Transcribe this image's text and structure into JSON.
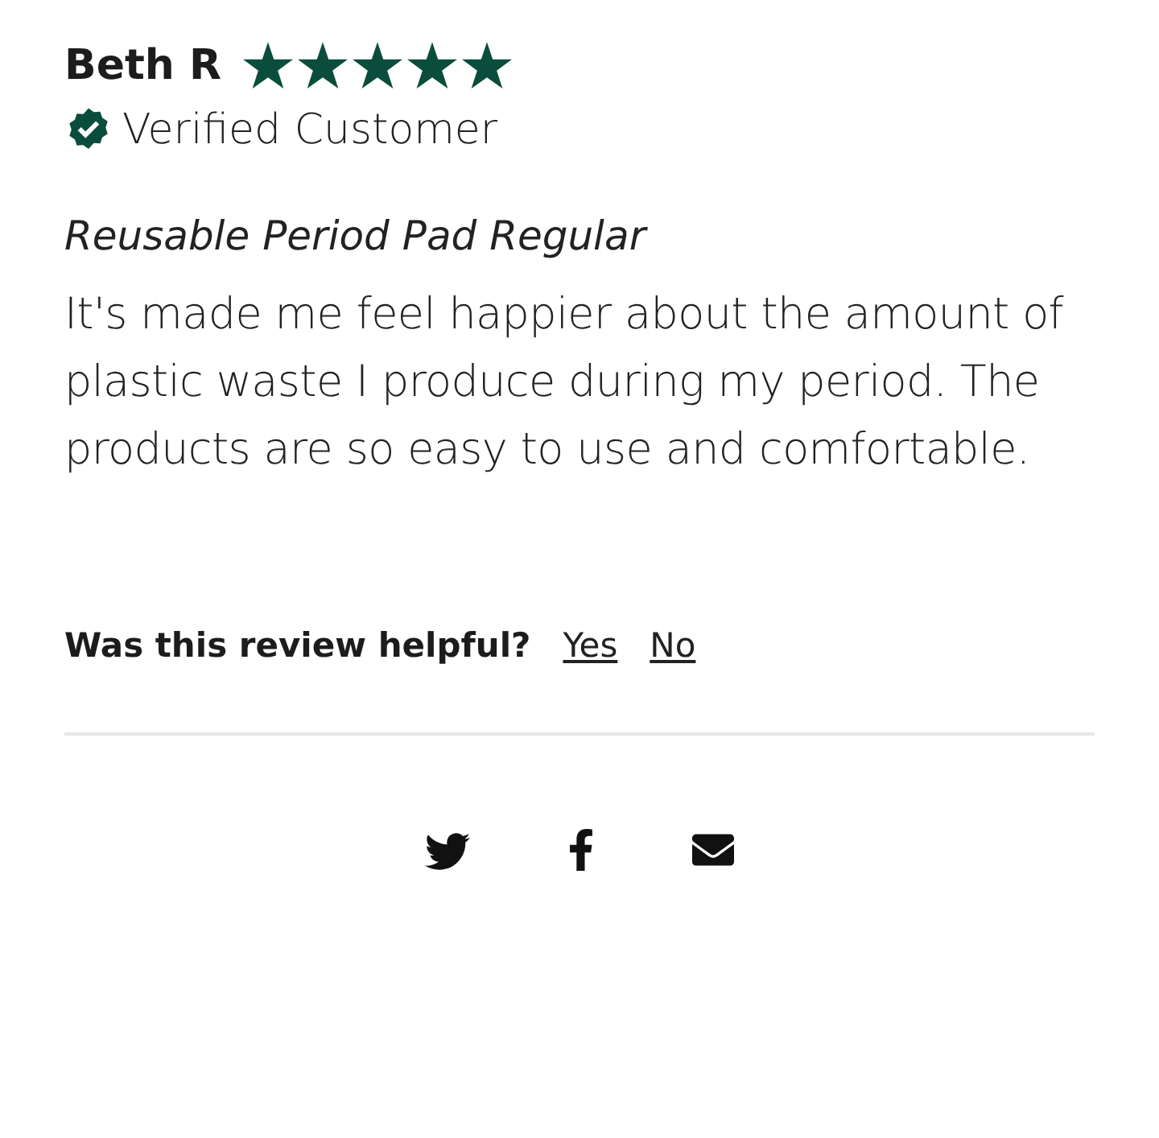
{
  "review": {
    "author": "Beth R",
    "stars": 5,
    "verified": true,
    "verified_label": "Verified Customer",
    "product": "Reusable Period Pad Regular",
    "body": "It's made me feel happier about the amount of plastic waste I produce during my period. The products are so easy to use and comfortable."
  },
  "helpful": {
    "question": "Was this review helpful?",
    "options": [
      "Yes",
      "No"
    ]
  }
}
